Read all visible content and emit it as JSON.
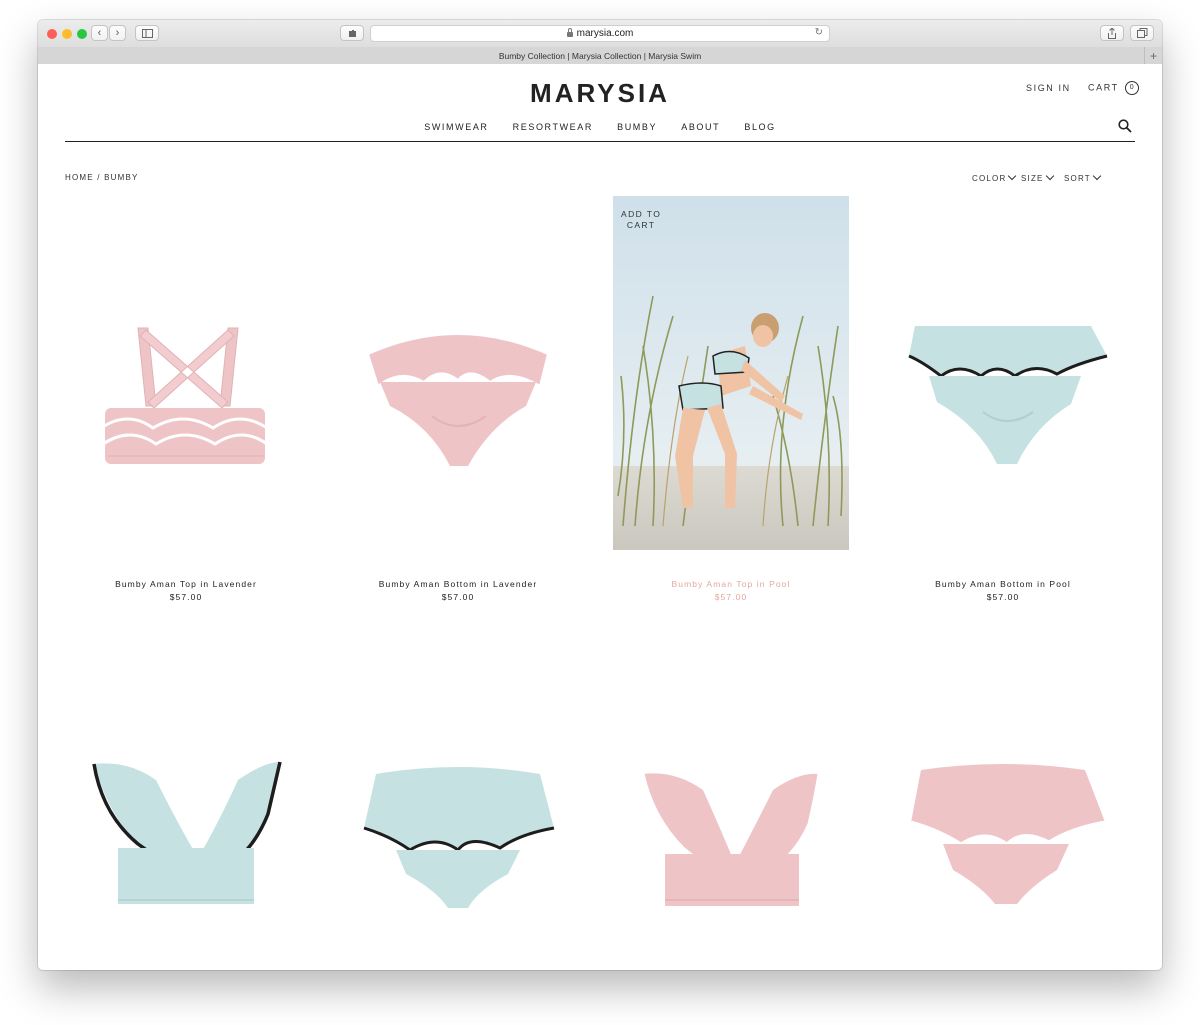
{
  "browser": {
    "url": "marysia.com",
    "tab_title": "Bumby Collection | Marysia Collection | Marysia Swim"
  },
  "header": {
    "logo": "MARYSIA",
    "sign_in": "SIGN IN",
    "cart_label": "CART",
    "cart_count": "0"
  },
  "nav": [
    "SWIMWEAR",
    "RESORTWEAR",
    "BUMBY",
    "ABOUT",
    "BLOG"
  ],
  "breadcrumb": "HOME / BUMBY",
  "filters": {
    "color": "COLOR",
    "size": "SIZE",
    "sort": "SORT"
  },
  "hover_action": "ADD TO CART",
  "products": [
    {
      "name": "Bumby Aman Top in Lavender",
      "price": "$57.00"
    },
    {
      "name": "Bumby Aman Bottom in Lavender",
      "price": "$57.00"
    },
    {
      "name": "Bumby Aman Top in Pool",
      "price": "$57.00"
    },
    {
      "name": "Bumby Aman Bottom in Pool",
      "price": "$57.00"
    }
  ],
  "colors": {
    "lavender": "#efc4c7",
    "pool": "#c5e1e2",
    "highlight": "#e3a99d",
    "text": "#222222"
  }
}
